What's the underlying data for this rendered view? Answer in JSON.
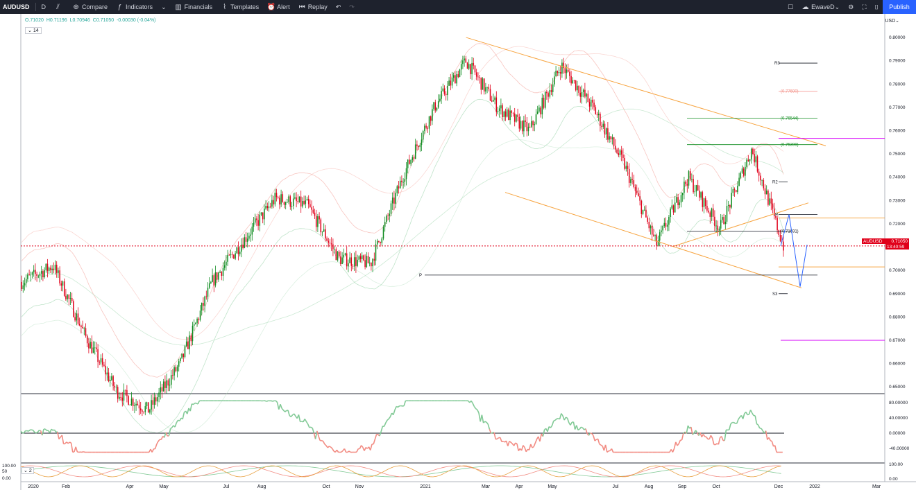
{
  "toolbar": {
    "symbol": "AUDUSD",
    "interval": "D",
    "compare": "Compare",
    "indicators": "Indicators",
    "financials": "Financials",
    "templates": "Templates",
    "alert": "Alert",
    "replay": "Replay",
    "user": "EwaveD",
    "publish": "Publish"
  },
  "legend": {
    "open": "O.71020",
    "high": "H0.71196",
    "low": "L0.70946",
    "close": "C0.71050",
    "change": "-0.00030 (-0.04%)",
    "collapse": "14"
  },
  "currency": "USD",
  "price_tag": {
    "symbol": "AUDUSD",
    "price": "0.71050",
    "countdown": "13:40:59"
  },
  "indicator2_label": "2",
  "price_axis": [
    "0.80000",
    "0.79000",
    "0.78000",
    "0.77000",
    "0.76000",
    "0.75000",
    "0.74000",
    "0.73000",
    "0.72000",
    "0.71000",
    "0.70000",
    "0.69000",
    "0.68000",
    "0.67000",
    "0.66000",
    "0.65000"
  ],
  "osc_axis": [
    "80.00000",
    "40.00000",
    "0.00000",
    "-40.00000"
  ],
  "osc2_axis_right": [
    "100.00",
    "0.00"
  ],
  "osc2_axis_left": [
    "100.00",
    "50",
    "0.00"
  ],
  "time_axis": [
    "2020",
    "Feb",
    "Apr",
    "May",
    "Jul",
    "Aug",
    "Oct",
    "Nov",
    "2021",
    "Mar",
    "Apr",
    "May",
    "Jul",
    "Aug",
    "Sep",
    "Oct",
    "Dec",
    "2022",
    "Mar"
  ],
  "annotations": {
    "r3": "R3",
    "r2": "R2",
    "p_upper": "P",
    "p_lower": "P",
    "s3": "S3",
    "fib1": "(0.77690)",
    "fib2": "(0.76544)",
    "fib3": "(0.75399)",
    "fib4": "(0.71691)"
  },
  "colors": {
    "up": "#0e8b1f",
    "down": "#e0001a",
    "channel": "#f7a440",
    "accent": "#2962ff"
  },
  "chart_data": {
    "type": "candlestick",
    "symbol": "AUDUSD",
    "ylim": [
      0.645,
      0.803
    ],
    "close_path": [
      {
        "x": "2020-01",
        "y": 0.695
      },
      {
        "x": "2020-01-15",
        "y": 0.702
      },
      {
        "x": "2020-02",
        "y": 0.672
      },
      {
        "x": "2020-03",
        "y": 0.648
      },
      {
        "x": "2020-04",
        "y": 0.64
      },
      {
        "x": "2020-05",
        "y": 0.66
      },
      {
        "x": "2020-06",
        "y": 0.695
      },
      {
        "x": "2020-07",
        "y": 0.713
      },
      {
        "x": "2020-08",
        "y": 0.731
      },
      {
        "x": "2020-09",
        "y": 0.728
      },
      {
        "x": "2020-10",
        "y": 0.705
      },
      {
        "x": "2020-11",
        "y": 0.703
      },
      {
        "x": "2020-12",
        "y": 0.74
      },
      {
        "x": "2021-01",
        "y": 0.77
      },
      {
        "x": "2021-02",
        "y": 0.79
      },
      {
        "x": "2021-03",
        "y": 0.77
      },
      {
        "x": "2021-04",
        "y": 0.76
      },
      {
        "x": "2021-05",
        "y": 0.788
      },
      {
        "x": "2021-06",
        "y": 0.77
      },
      {
        "x": "2021-07",
        "y": 0.745
      },
      {
        "x": "2021-08",
        "y": 0.711
      },
      {
        "x": "2021-09",
        "y": 0.74
      },
      {
        "x": "2021-10",
        "y": 0.718
      },
      {
        "x": "2021-11",
        "y": 0.752
      },
      {
        "x": "2021-12",
        "y": 0.7105
      }
    ]
  }
}
